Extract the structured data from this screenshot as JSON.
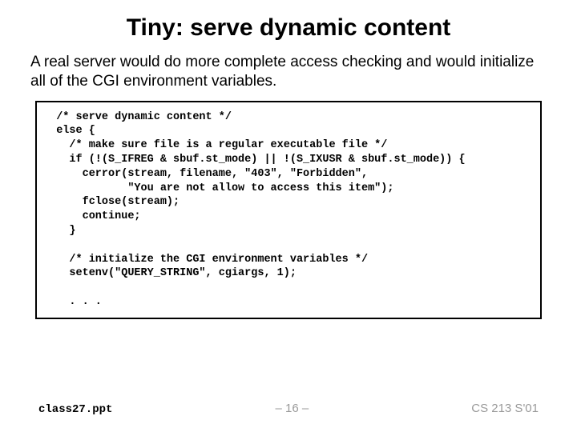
{
  "title": "Tiny: serve dynamic content",
  "body": "A real server would do more complete access checking and would initialize all of the CGI environment variables.",
  "code": "  /* serve dynamic content */\n  else {\n    /* make sure file is a regular executable file */\n    if (!(S_IFREG & sbuf.st_mode) || !(S_IXUSR & sbuf.st_mode)) {\n      cerror(stream, filename, \"403\", \"Forbidden\",\n             \"You are not allow to access this item\");\n      fclose(stream);\n      continue;\n    }\n\n    /* initialize the CGI environment variables */\n    setenv(\"QUERY_STRING\", cgiargs, 1);\n\n    . . .",
  "footer": {
    "left": "class27.ppt",
    "center": "– 16 –",
    "right": "CS 213 S'01"
  }
}
